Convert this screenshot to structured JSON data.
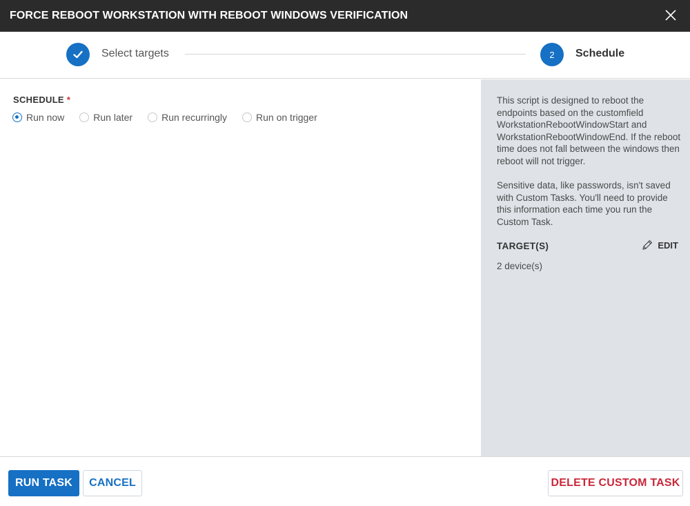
{
  "dialog": {
    "title": "FORCE REBOOT WORKSTATION WITH REBOOT WINDOWS VERIFICATION",
    "close_icon": "close-icon"
  },
  "stepper": {
    "step1": {
      "label": "Select targets",
      "state": "completed",
      "icon": "check-icon"
    },
    "step2": {
      "number": "2",
      "label": "Schedule",
      "state": "active"
    }
  },
  "schedule": {
    "heading": "SCHEDULE",
    "required_marker": "*",
    "options": [
      "Run now",
      "Run later",
      "Run recurringly",
      "Run on trigger"
    ],
    "selected": "Run now"
  },
  "side": {
    "description_1": "This script is designed to reboot the endpoints based on the customfield WorkstationRebootWindowStart and WorkstationRebootWindowEnd. If the reboot time does not fall between the windows then reboot will not trigger.",
    "description_2": "Sensitive data, like passwords, isn't saved with Custom Tasks. You'll need to provide this information each time you run the Custom Task.",
    "targets_heading": "TARGET(S)",
    "edit_label": "EDIT",
    "targets_count": "2 device(s)"
  },
  "footer": {
    "run_label": "RUN TASK",
    "cancel_label": "CANCEL",
    "delete_label": "DELETE CUSTOM TASK"
  },
  "colors": {
    "accent": "#1670c4",
    "titlebar": "#2b2b2b",
    "side_panel": "#dfe3e8",
    "danger": "#c8283a",
    "required": "#d0312d"
  }
}
